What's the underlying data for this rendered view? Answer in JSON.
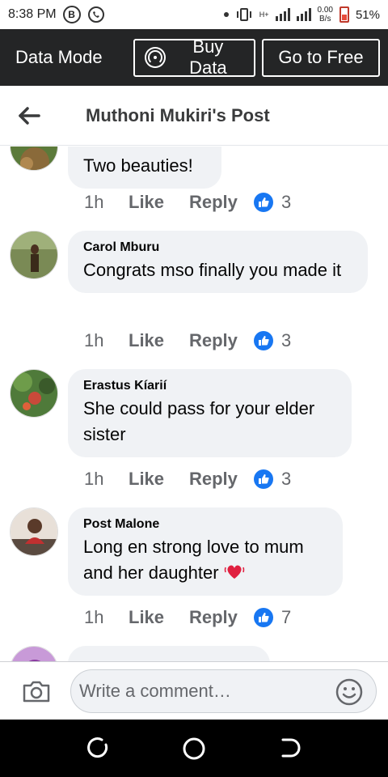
{
  "status_bar": {
    "time": "8:38 PM",
    "app_icon_letter": "B",
    "net_speed_value": "0.00",
    "net_speed_unit": "B/s",
    "battery": "51%",
    "network_type": "H+"
  },
  "data_bar": {
    "label": "Data Mode",
    "buy_button": "Buy Data",
    "free_button": "Go to Free"
  },
  "header": {
    "title": "Muthoni  Mukiri's Post"
  },
  "comments": [
    {
      "author": "",
      "text": "Two beauties!",
      "time": "1h",
      "like_label": "Like",
      "reply_label": "Reply",
      "reactions": "3"
    },
    {
      "author": "Carol Mburu",
      "text": "Congrats mso finally you made it",
      "time": "1h",
      "like_label": "Like",
      "reply_label": "Reply",
      "reactions": "3"
    },
    {
      "author": "Erastus Kíarií",
      "text": "She could pass for your elder sister",
      "time": "1h",
      "like_label": "Like",
      "reply_label": "Reply",
      "reactions": "3"
    },
    {
      "author": "Post Malone",
      "text": "Long en strong love to mum and her daughter",
      "time": "1h",
      "like_label": "Like",
      "reply_label": "Reply",
      "reactions": "7"
    }
  ],
  "composer": {
    "placeholder": "Write a comment…"
  },
  "colors": {
    "data_bar_bg": "#242526",
    "bubble_bg": "#f0f2f5",
    "like_blue": "#1877f2",
    "muted_text": "#65676b"
  }
}
